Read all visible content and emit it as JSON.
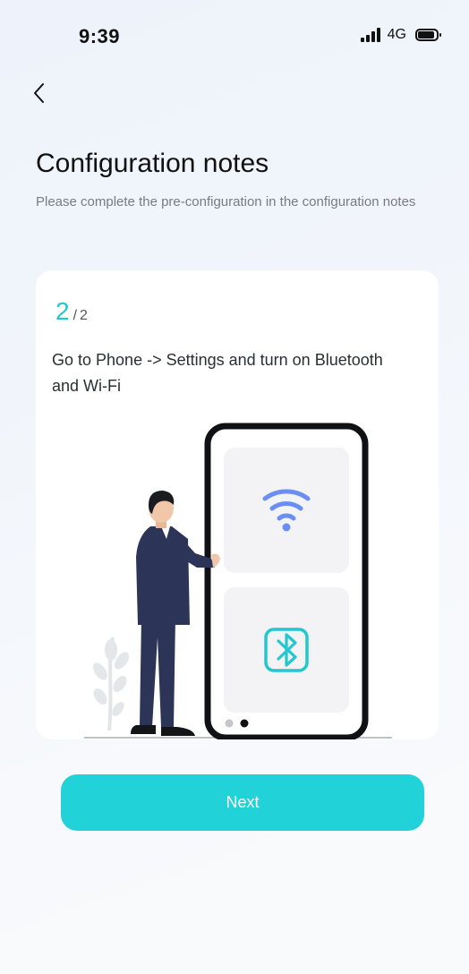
{
  "status_bar": {
    "time": "9:39",
    "network": "4G"
  },
  "header": {
    "back_icon": "chevron-left-icon",
    "title": "Configuration notes",
    "subtitle": "Please complete the pre-configuration in the configuration notes"
  },
  "card": {
    "step_current": "2",
    "step_separator": "/",
    "step_total": "2",
    "description": "Go to Phone -> Settings and turn on Bluetooth and Wi-Fi",
    "illustration_icons": [
      "wifi-icon",
      "bluetooth-icon"
    ],
    "carousel_dots": {
      "count": 2,
      "active_index": 1
    }
  },
  "actions": {
    "next_label": "Next"
  },
  "colors": {
    "accent": "#22c7cf",
    "button": "#21d3d8",
    "wifi": "#6b8ef2",
    "bluetooth": "#22c7cf",
    "suit": "#2c3558"
  }
}
